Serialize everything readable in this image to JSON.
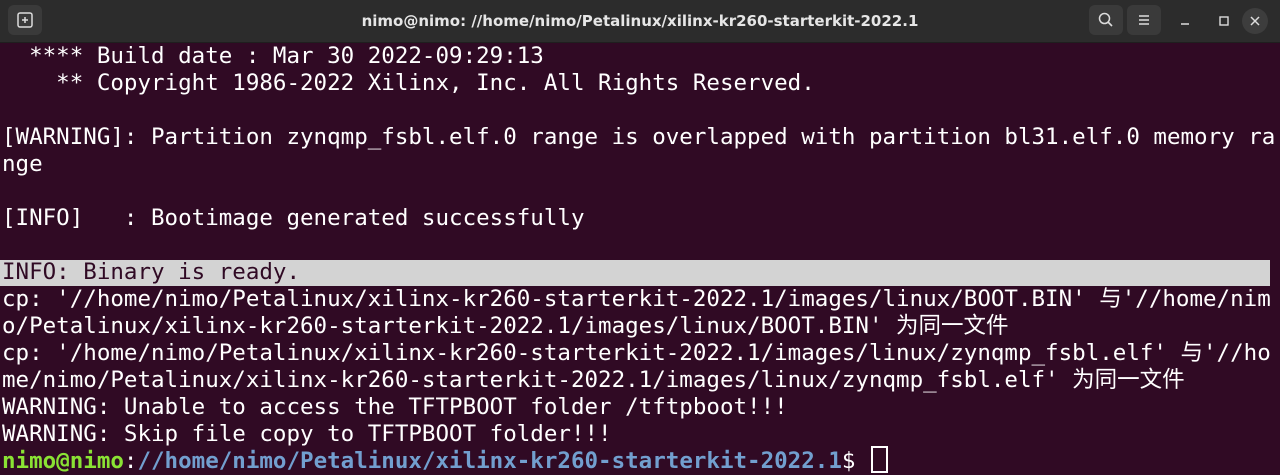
{
  "window": {
    "title": "nimo@nimo: //home/nimo/Petalinux/xilinx-kr260-starterkit-2022.1"
  },
  "terminal": {
    "lines": [
      "  **** Build date : Mar 30 2022-09:29:13",
      "    ** Copyright 1986-2022 Xilinx, Inc. All Rights Reserved.",
      "",
      "[WARNING]: Partition zynqmp_fsbl.elf.0 range is overlapped with partition bl31.elf.0 memory ra",
      "nge",
      "",
      "[INFO]   : Bootimage generated successfully",
      "",
      "INFO: Binary is ready.",
      "cp: '//home/nimo/Petalinux/xilinx-kr260-starterkit-2022.1/images/linux/BOOT.BIN' 与'//home/nim",
      "o/Petalinux/xilinx-kr260-starterkit-2022.1/images/linux/BOOT.BIN' 为同一文件",
      "cp: '/home/nimo/Petalinux/xilinx-kr260-starterkit-2022.1/images/linux/zynqmp_fsbl.elf' 与'//ho",
      "me/nimo/Petalinux/xilinx-kr260-starterkit-2022.1/images/linux/zynqmp_fsbl.elf' 为同一文件",
      "WARNING: Unable to access the TFTPBOOT folder /tftpboot!!!",
      "WARNING: Skip file copy to TFTPBOOT folder!!!"
    ],
    "prompt": {
      "user_host": "nimo@nimo",
      "colon": ":",
      "path": "//home/nimo/Petalinux/xilinx-kr260-starterkit-2022.1",
      "symbol": "$ "
    }
  },
  "colors": {
    "background": "#300a24",
    "titlebar": "#2c2c2c",
    "prompt_user": "#8ae234",
    "prompt_path": "#729fcf",
    "highlight": "#d3d3d3"
  },
  "icons": {
    "new_tab": "new-tab-icon",
    "search": "search-icon",
    "menu": "hamburger-menu-icon",
    "minimize": "minimize-icon",
    "maximize": "maximize-icon",
    "close": "close-icon"
  }
}
